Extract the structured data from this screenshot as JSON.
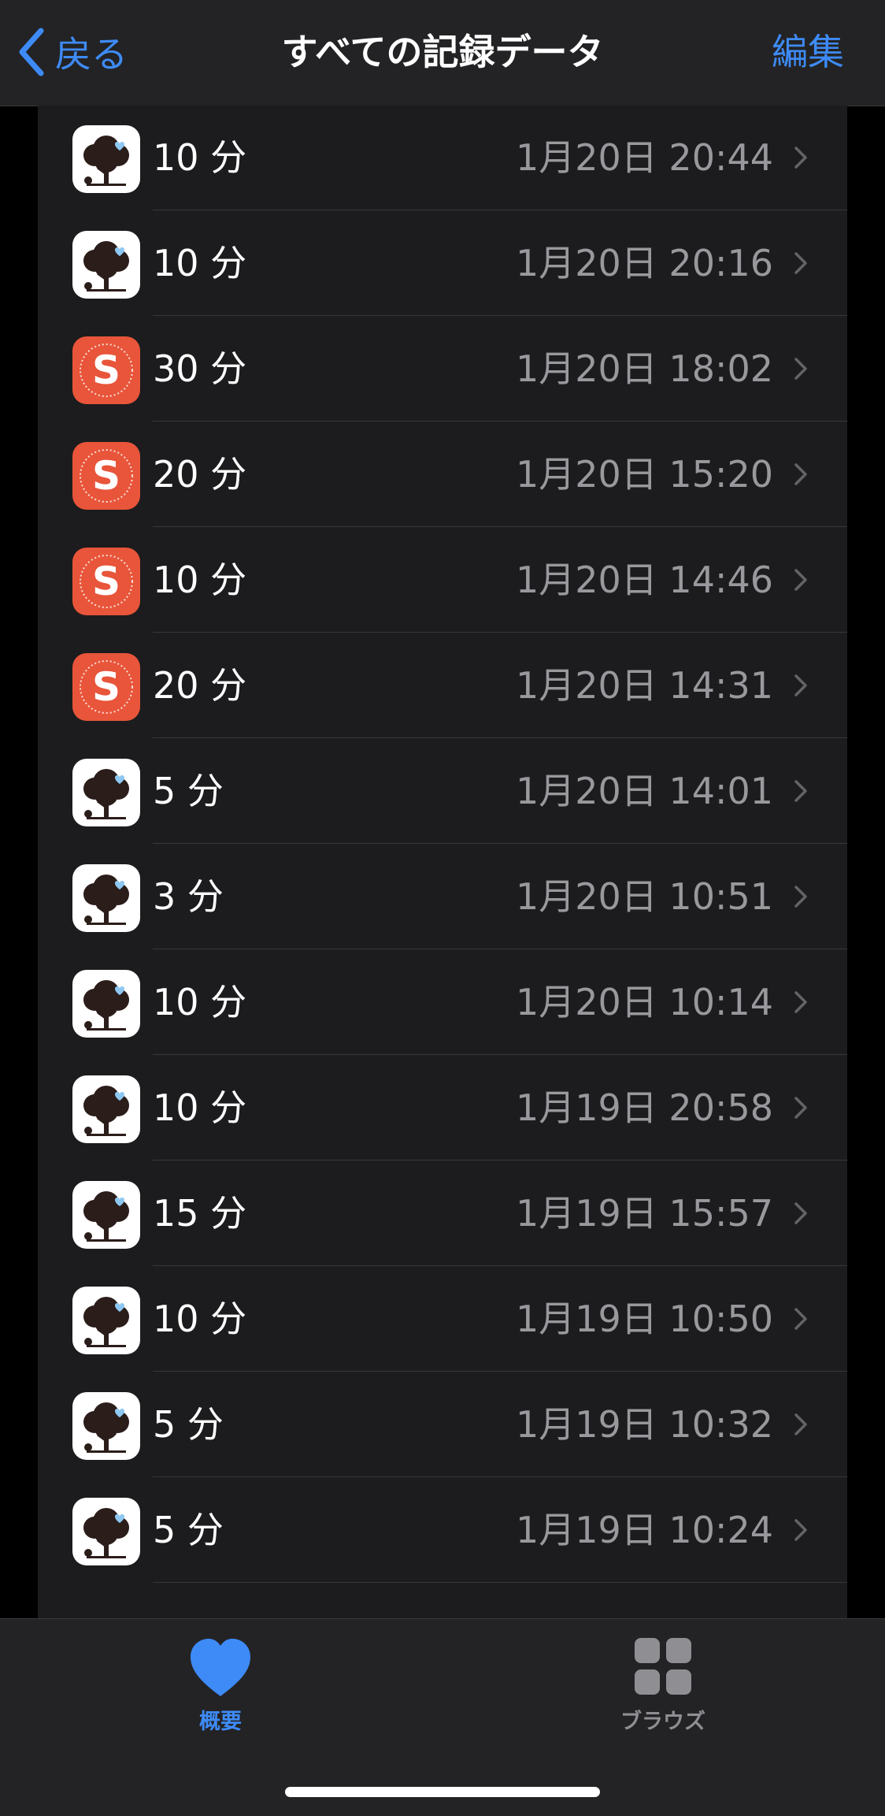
{
  "nav": {
    "back_label": "戻る",
    "title": "すべての記録データ",
    "edit_label": "編集"
  },
  "records": [
    {
      "app": "tree",
      "duration": "10 分",
      "date": "1月20日 20:44"
    },
    {
      "app": "tree",
      "duration": "10 分",
      "date": "1月20日 20:16"
    },
    {
      "app": "s",
      "duration": "30 分",
      "date": "1月20日 18:02"
    },
    {
      "app": "s",
      "duration": "20 分",
      "date": "1月20日 15:20"
    },
    {
      "app": "s",
      "duration": "10 分",
      "date": "1月20日 14:46"
    },
    {
      "app": "s",
      "duration": "20 分",
      "date": "1月20日 14:31"
    },
    {
      "app": "tree",
      "duration": "5 分",
      "date": "1月20日 14:01"
    },
    {
      "app": "tree",
      "duration": "3 分",
      "date": "1月20日 10:51"
    },
    {
      "app": "tree",
      "duration": "10 分",
      "date": "1月20日 10:14"
    },
    {
      "app": "tree",
      "duration": "10 分",
      "date": "1月19日 20:58"
    },
    {
      "app": "tree",
      "duration": "15 分",
      "date": "1月19日 15:57"
    },
    {
      "app": "tree",
      "duration": "10 分",
      "date": "1月19日 10:50"
    },
    {
      "app": "tree",
      "duration": "5 分",
      "date": "1月19日 10:32"
    },
    {
      "app": "tree",
      "duration": "5 分",
      "date": "1月19日 10:24"
    }
  ],
  "tabs": {
    "summary_label": "概要",
    "browse_label": "ブラウズ"
  },
  "colors": {
    "accent": "#3e8bf7",
    "list_background": "#1c1c1e",
    "secondary_text": "#98989d",
    "s_app_orange": "#e8553a"
  }
}
